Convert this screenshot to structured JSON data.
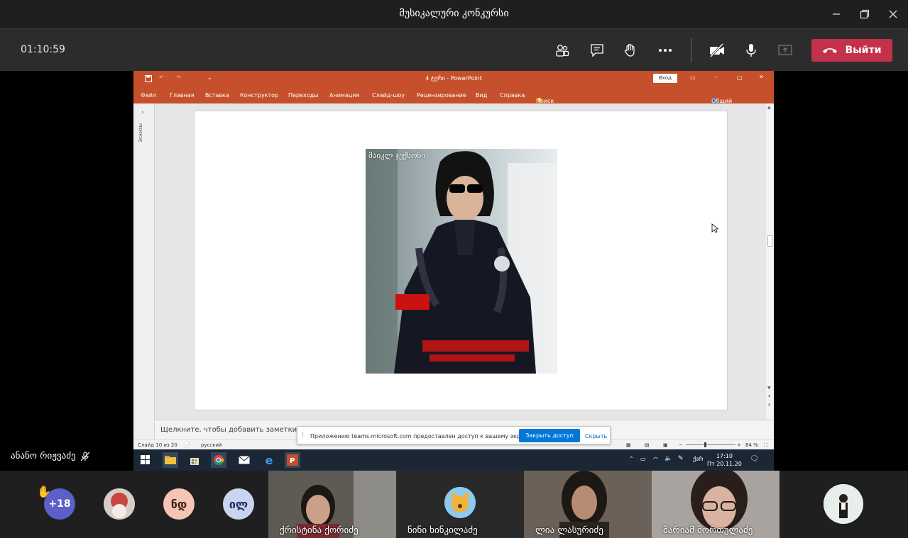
{
  "window": {
    "title": "მუსიკალური კონკურსი",
    "controls": [
      "minimize",
      "restore",
      "close"
    ]
  },
  "toolbar": {
    "timer": "01:10:59",
    "leave_label": "Выйти",
    "accent": "#c4314b"
  },
  "powerpoint": {
    "doc_title": "4 ტური  -  PowerPoint",
    "signin_label": "Вход",
    "menu": [
      "Файл",
      "Главная",
      "Вставка",
      "Конструктор",
      "Переходы",
      "Анимация",
      "Слайд-шоу",
      "Рецензирование",
      "Вид",
      "Справка",
      "Поиск"
    ],
    "share_label": "Общий доступ",
    "thumbnails_label": "Эскизы",
    "slide_caption": "მაიკლ ჯექსონი",
    "notes_placeholder": "Щелкните, чтобы добавить заметки",
    "status_slide": "Слайд 10 из 20",
    "status_lang": "русский",
    "zoom": "84 %",
    "ribbon_color": "#c6502b"
  },
  "share_banner": {
    "message": "Приложению teams.microsoft.com предоставлен доступ к вашему экрану.",
    "stop_label": "Закрыть доступ",
    "hide_label": "Скрыть"
  },
  "taskbar": {
    "lang": "ქარ",
    "time": "17:10",
    "date": "Пт 20.11.20"
  },
  "presenter": {
    "name": "ანანო რიჟვაძე"
  },
  "participants": {
    "overflow": "+18",
    "avatars": [
      {
        "initials": "ნდ",
        "color": "#f7c5b6"
      },
      {
        "initials": "ილ",
        "color": "#c9d4ef"
      }
    ],
    "tiles": [
      {
        "name": "ქრისტინა ქორიძე"
      },
      {
        "name": "ნინი ხინკილაძე"
      },
      {
        "name": "ლია ლასურიძე"
      },
      {
        "name": "მარიამ მორთულაძე"
      }
    ]
  }
}
